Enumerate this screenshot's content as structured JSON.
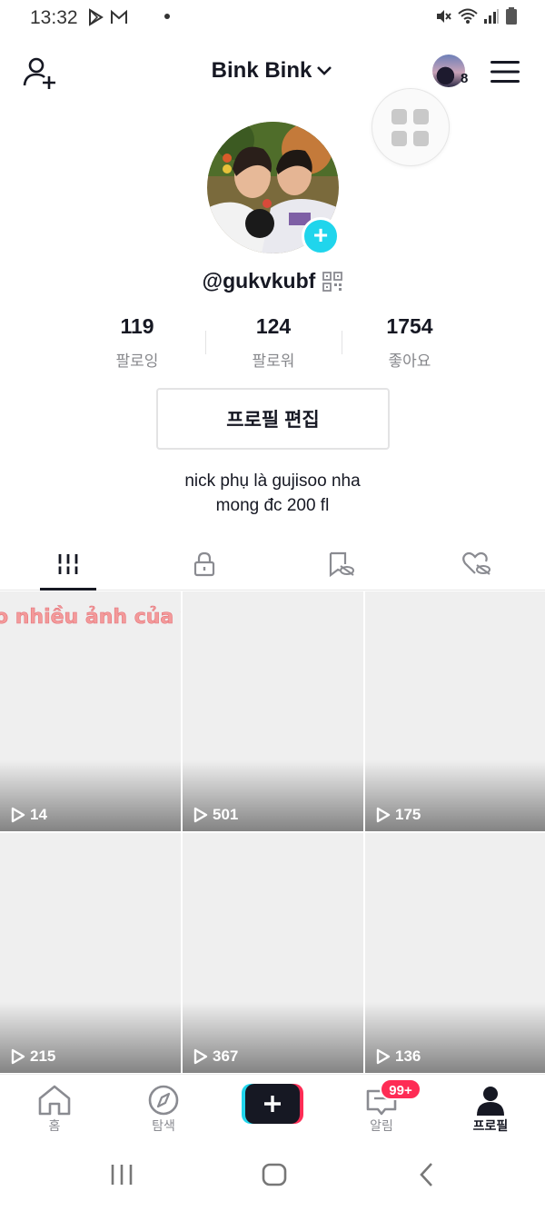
{
  "status_bar": {
    "time": "13:32",
    "icons": [
      "play-store-icon",
      "gmail-icon",
      "mute-icon",
      "wifi-icon",
      "signal-icon",
      "battery-icon"
    ]
  },
  "header": {
    "title": "Bink Bink",
    "story_count": "8"
  },
  "profile": {
    "username": "@gukvkubf",
    "stats": [
      {
        "value": "119",
        "label": "팔로잉"
      },
      {
        "value": "124",
        "label": "팔로워"
      },
      {
        "value": "1754",
        "label": "좋아요"
      }
    ],
    "edit_button": "프로필 편집",
    "bio_line1": "nick phụ là gujisoo nha",
    "bio_line2": "mong đc 200 fl"
  },
  "tabs": [
    "videos-grid-icon",
    "lock-icon",
    "bookmark-hidden-icon",
    "liked-hidden-icon"
  ],
  "videos": [
    {
      "views": "14",
      "caption": "o nhiều ảnh của vợ"
    },
    {
      "views": "501",
      "caption": ""
    },
    {
      "views": "175",
      "caption": ""
    },
    {
      "views": "215",
      "caption": ""
    },
    {
      "views": "367",
      "caption": ""
    },
    {
      "views": "136",
      "caption": ""
    }
  ],
  "bottom_nav": {
    "home": "홈",
    "discover": "탐색",
    "inbox": "알림",
    "inbox_badge": "99+",
    "profile": "프로필"
  },
  "colors": {
    "accent_cyan": "#20d5ec",
    "accent_red": "#fe2c55",
    "text_primary": "#161823",
    "text_secondary": "#86878b"
  }
}
